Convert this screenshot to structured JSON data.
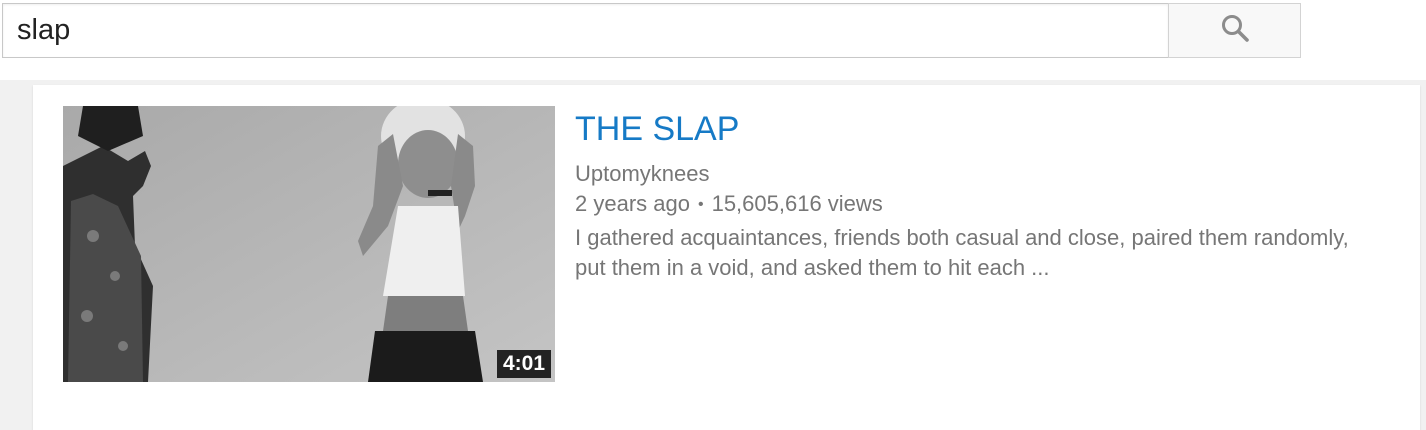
{
  "search": {
    "query": "slap",
    "button_icon": "search-icon"
  },
  "result": {
    "title": "THE SLAP",
    "channel": "Uptomyknees",
    "age": "2 years ago",
    "views": "15,605,616 views",
    "separator": "•",
    "description": "I gathered acquaintances, friends both casual and close, paired them randomly, put them in a void, and asked them to hit each ...",
    "duration": "4:01",
    "title_color": "#167ac6"
  }
}
